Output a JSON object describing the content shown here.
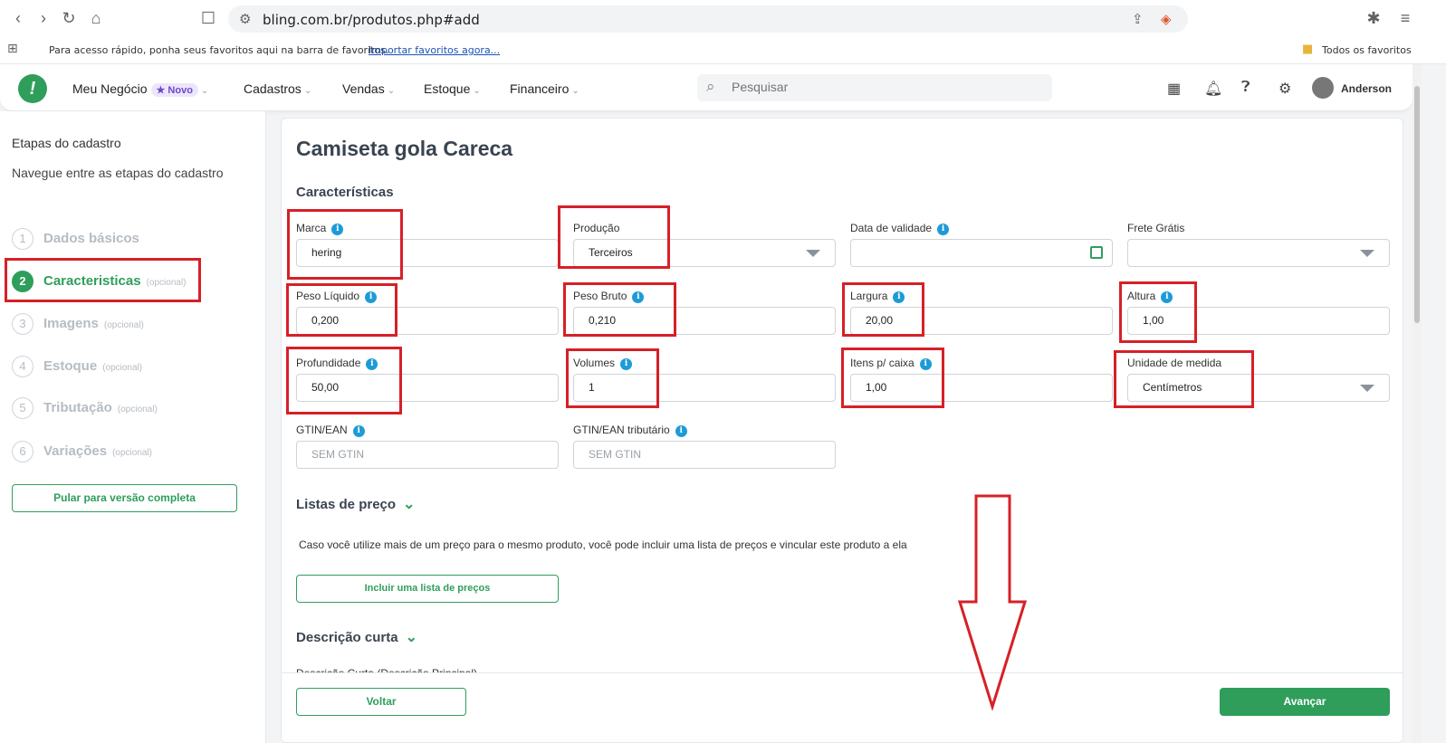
{
  "browser": {
    "url": "bling.com.br/produtos.php#add",
    "bookmarks_text": "Para acesso rápido, ponha seus favoritos aqui na barra de favoritos.",
    "bookmarks_link": "Importar favoritos agora...",
    "bookmarks_folder": "Todos os favoritos"
  },
  "header": {
    "menu": {
      "meu_negocio": "Meu Negócio",
      "novo_badge": "★ Novo",
      "cadastros": "Cadastros",
      "vendas": "Vendas",
      "estoque": "Estoque",
      "financeiro": "Financeiro"
    },
    "search_placeholder": "Pesquisar",
    "user_name": "Anderson"
  },
  "sidebar": {
    "title": "Etapas do cadastro",
    "subtitle": "Navegue entre as etapas do cadastro",
    "steps": [
      {
        "num": "1",
        "label": "Dados básicos",
        "optional": ""
      },
      {
        "num": "2",
        "label": "Caracteristicas",
        "optional": "(opcional)"
      },
      {
        "num": "3",
        "label": "Imagens",
        "optional": "(opcional)"
      },
      {
        "num": "4",
        "label": "Estoque",
        "optional": "(opcional)"
      },
      {
        "num": "5",
        "label": "Tributação",
        "optional": "(opcional)"
      },
      {
        "num": "6",
        "label": "Variações",
        "optional": "(opcional)"
      }
    ],
    "full_version_button": "Pular para versão completa"
  },
  "main": {
    "title": "Camiseta gola Careca",
    "section_characteristics": "Características",
    "fields": {
      "marca": {
        "label": "Marca",
        "value": "hering"
      },
      "producao": {
        "label": "Produção",
        "value": "Terceiros"
      },
      "data_validade": {
        "label": "Data de validade",
        "value": ""
      },
      "frete_gratis": {
        "label": "Frete Grátis",
        "value": ""
      },
      "peso_liquido": {
        "label": "Peso Líquido",
        "value": "0,200"
      },
      "peso_bruto": {
        "label": "Peso Bruto",
        "value": "0,210"
      },
      "largura": {
        "label": "Largura",
        "value": "20,00"
      },
      "altura": {
        "label": "Altura",
        "value": "1,00"
      },
      "profundidade": {
        "label": "Profundidade",
        "value": "50,00"
      },
      "volumes": {
        "label": "Volumes",
        "value": "1"
      },
      "itens_caixa": {
        "label": "Itens p/ caixa",
        "value": "1,00"
      },
      "unidade_medida": {
        "label": "Unidade de medida",
        "value": "Centímetros"
      },
      "gtin": {
        "label": "GTIN/EAN",
        "placeholder": "SEM GTIN"
      },
      "gtin_tributario": {
        "label": "GTIN/EAN tributário",
        "placeholder": "SEM GTIN"
      }
    },
    "section_price_lists": "Listas de preço",
    "price_lists_desc": "Caso você utilize mais de um preço para o mesmo produto, você pode incluir uma lista de preços e vincular este produto a ela",
    "add_price_list_button": "Incluir uma lista de preços",
    "section_short_desc": "Descrição curta",
    "short_desc_label": "Descrição Curta (Descrição Principal)",
    "back_button": "Voltar",
    "next_button": "Avançar"
  },
  "colors": {
    "brand_green": "#2f9e5b",
    "highlight_red": "#d62027",
    "info_blue": "#1e9bd7"
  }
}
